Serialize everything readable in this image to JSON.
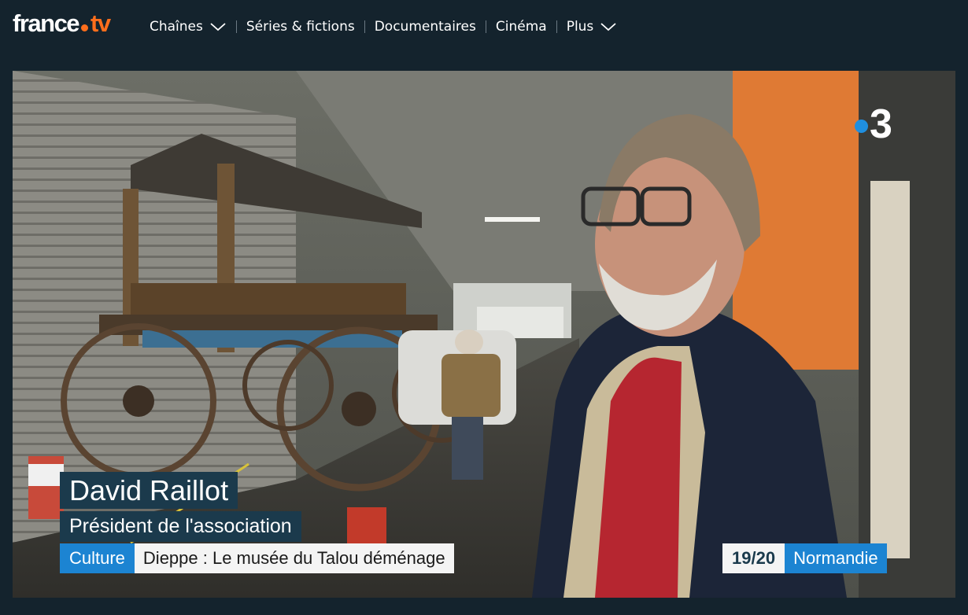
{
  "header": {
    "logo": {
      "left": "france",
      "right": "tv"
    },
    "nav": [
      {
        "label": "Chaînes",
        "dropdown": true
      },
      {
        "label": "Séries & fictions",
        "dropdown": false
      },
      {
        "label": "Documentaires",
        "dropdown": false
      },
      {
        "label": "Cinéma",
        "dropdown": false
      },
      {
        "label": "Plus",
        "dropdown": true
      }
    ]
  },
  "video": {
    "channel_number": "3",
    "lower_third": {
      "name": "David Raillot",
      "role": "Président de l'association",
      "category": "Culture",
      "headline": "Dieppe : Le musée du Talou déménage"
    },
    "program": {
      "time": "19/20",
      "region": "Normandie"
    }
  },
  "colors": {
    "header_bg": "#14232d",
    "logo_dot": "#ff6e1c",
    "channel_blue": "#1f8fe0",
    "accent_blue": "#1c84d2",
    "lower_third_bg": "#1b3a4c"
  }
}
